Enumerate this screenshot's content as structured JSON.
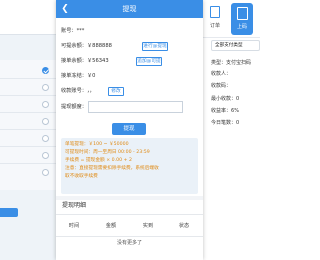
{
  "modal": {
    "title": "提现",
    "back_icon": "back-arrow-icon",
    "account": {
      "label": "账号：",
      "value": "***"
    },
    "withdrawable": {
      "label": "可提余额：",
      "value": "￥888888",
      "button": "进行@提现"
    },
    "reserved": {
      "label": "接单余额：",
      "value": "￥56343",
      "button": "追加@可提"
    },
    "frozen": {
      "label": "接单冻结：",
      "value": "￥0"
    },
    "receive": {
      "label": "收款账号：",
      "value": "，，",
      "button": "修改"
    },
    "withdraw_amount": {
      "label": "提现额度：",
      "value": "",
      "placeholder": ""
    },
    "submit_label": "提现",
    "notices": [
      "单笔提现：￥100 ~ ￥50000",
      "可提现时间：周一至周日 00:00 - 23:59",
      "手续费 = 提现金额 × 0.00 + 2",
      "注意：直接提现需要扣除手续费，系统后端收",
      "取不收取手续费"
    ],
    "records": {
      "title": "提现明细",
      "columns": [
        "时间",
        "金额",
        "实到",
        "状态"
      ],
      "empty": "没有更多了"
    }
  },
  "right_panel": {
    "tabs": [
      {
        "label": "订单",
        "icon": "document-icon"
      },
      {
        "label": "上码",
        "icon": "upload-code-icon"
      }
    ],
    "pay_type": "全部支付类型",
    "rows": [
      {
        "label": "类型：",
        "value": "支付宝扫码"
      },
      {
        "label": "收款人：",
        "value": ""
      },
      {
        "label": "收款码：",
        "value": ""
      },
      {
        "label": "最小收款：",
        "value": "0"
      },
      {
        "label": "收益率：",
        "value": "6%"
      },
      {
        "label": "今日笔数：",
        "value": "0"
      }
    ]
  },
  "colors": {
    "primary": "#3a8ee6",
    "notice_text": "#e08a13",
    "notice_bg": "#eaf1f8"
  }
}
